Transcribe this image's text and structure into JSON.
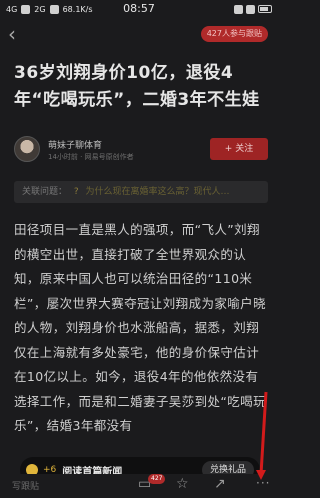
{
  "status_bar": {
    "signal_left": "4G",
    "signal_right": "2G",
    "speed": "68.1K/s",
    "time": "08:57",
    "icons": [
      "signal-icon",
      "wifi-icon",
      "battery-icon"
    ]
  },
  "header": {
    "participants": "427人参与跟贴"
  },
  "article": {
    "title": "36岁刘翔身价10亿，退役4年“吃喝玩乐”，二婚3年不生娃",
    "author": "萌妹子聊体育",
    "meta": "14小时前 · 网易号原创作者",
    "follow_label": "+ 关注",
    "related_label": "关联问题：",
    "related_question": "为什么现在离婚率这么高？现代人…",
    "body": "田径项目一直是黑人的强项，而“飞人”刘翔的横空出世，直接打破了全世界观众的认知，原来中国人也可以统治田径的“110米栏”，屡次世界大赛夺冠让刘翔成为家喻户晓的人物，刘翔身价也水涨船高，据悉，刘翔仅在上海就有多处豪宅，他的身价保守估计在10亿以上。如今，退役4年的他依然没有选择工作，而是和二婚妻子吴莎到处“吃喝玩乐”，结婚3年都没有"
  },
  "toast": {
    "plus": "+6",
    "text": "阅读首篇新闻",
    "redeem_label": "兑换礼品"
  },
  "bottom_bar": {
    "comment_placeholder": "写跟贴",
    "comment_count": "427"
  },
  "colors": {
    "background": "#1b1b1d",
    "accent_red": "#9e2424",
    "coin_gold": "#e0b53b"
  }
}
